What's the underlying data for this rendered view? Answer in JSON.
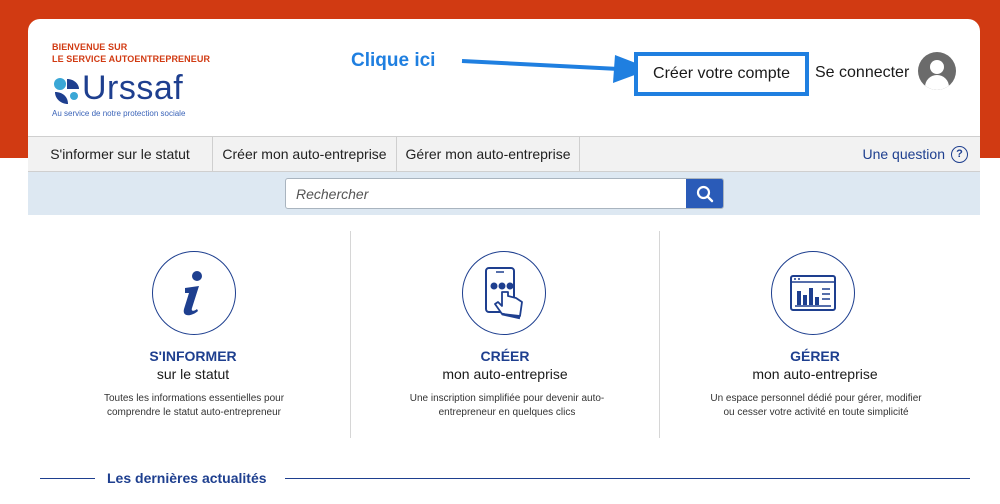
{
  "header": {
    "welcome_line1": "BIENVENUE SUR",
    "welcome_line2": "LE SERVICE AUTOENTREPRENEUR",
    "logo_text": "Urssaf",
    "logo_tagline": "Au service de notre protection sociale",
    "annotation": "Clique ici",
    "create_account": "Créer votre compte",
    "login": "Se connecter"
  },
  "nav": {
    "items": [
      {
        "label": "S'informer sur le statut"
      },
      {
        "label": "Créer mon auto-entreprise"
      },
      {
        "label": "Gérer mon auto-entreprise"
      }
    ],
    "question": "Une question",
    "question_icon_glyph": "?"
  },
  "search": {
    "placeholder": "Rechercher"
  },
  "features": [
    {
      "icon": "info-icon",
      "title": "S'INFORMER",
      "subtitle": "sur le statut",
      "description": "Toutes les informations essentielles pour comprendre le statut auto-entrepreneur"
    },
    {
      "icon": "tablet-touch-icon",
      "title": "CRÉER",
      "subtitle": "mon auto-entreprise",
      "description": "Une inscription simplifiée pour devenir auto-entrepreneur en quelques clics"
    },
    {
      "icon": "dashboard-chart-icon",
      "title": "GÉRER",
      "subtitle": "mon auto-entreprise",
      "description": "Un espace personnel dédié pour gérer, modifier ou cesser votre activité en toute simplicité"
    }
  ],
  "news": {
    "title": "Les dernières actualités"
  },
  "colors": {
    "brand_red": "#d13a12",
    "brand_blue": "#1e3f8f",
    "highlight_blue": "#1f7fe0",
    "search_band": "#dde8f2"
  }
}
